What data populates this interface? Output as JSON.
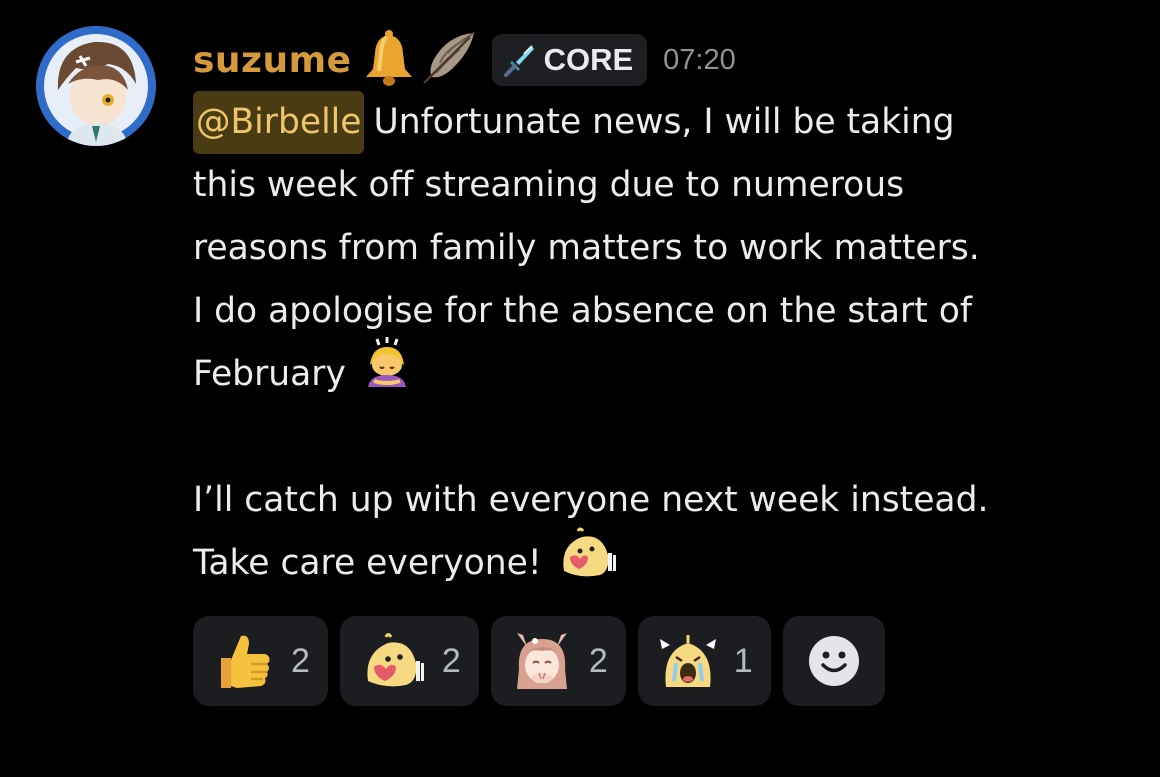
{
  "message": {
    "username": "suzume",
    "role_tag": "CORE",
    "timestamp": "07:20",
    "mention": "@Birbelle",
    "lines": [
      "Unfortunate news, I will be taking",
      "this week off streaming due to numerous",
      "reasons from family matters to work matters.",
      "I do apologise for the absence on the start of",
      "February",
      "",
      "I’ll catch up with everyone next week instead.",
      "Take care everyone!"
    ]
  },
  "reactions": [
    {
      "icon": "thumbs-up-icon",
      "count": "2"
    },
    {
      "icon": "bird-heart-emote-icon",
      "count": "2"
    },
    {
      "icon": "anime-girl-emote-icon",
      "count": "2"
    },
    {
      "icon": "crying-bird-emote-icon",
      "count": "1"
    }
  ],
  "colors": {
    "background": "#000000",
    "username": "#d49a3c",
    "mention_bg": "#4a3c12",
    "mention_text": "#f0c56b",
    "reaction_bg": "#1c1d21"
  }
}
